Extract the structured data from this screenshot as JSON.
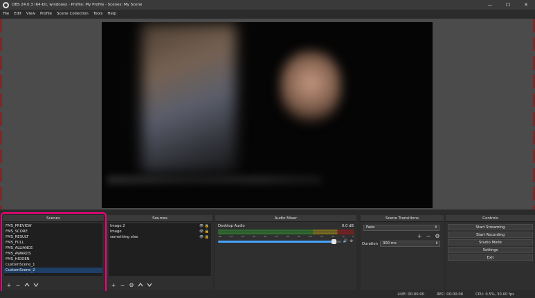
{
  "window": {
    "title": "OBS 24.0.3 (64-bit, windows) - Profile: My Profile - Scenes: My Scene",
    "minimize": "—",
    "maximize": "☐",
    "close": "✕"
  },
  "menu": [
    "File",
    "Edit",
    "View",
    "Profile",
    "Scene Collection",
    "Tools",
    "Help"
  ],
  "scenes": {
    "title": "Scenes",
    "items": [
      "FMS_PREVIEW",
      "FMS_SCORE",
      "FMS_RESULT",
      "FMS_FULL",
      "FMS_ALLIANCE",
      "FMS_AWARDS",
      "FMS_HIDDEN",
      "CustomScene_1",
      "CustomScene_2"
    ],
    "selected_index": 8
  },
  "sources": {
    "title": "Sources",
    "items": [
      "Image 2",
      "Image",
      "something else"
    ]
  },
  "mixer": {
    "title": "Audio Mixer",
    "track_name": "Desktop Audio",
    "track_level": "0.0 dB",
    "scale": [
      "-60",
      "-55",
      "-50",
      "-45",
      "-40",
      "-35",
      "-30",
      "-25",
      "-20",
      "-15",
      "-10",
      "-5",
      "0"
    ],
    "volume_fraction": 0.96
  },
  "transitions": {
    "title": "Scene Transitions",
    "selected": "Fade",
    "duration_label": "Duration",
    "duration_value": "300 ms"
  },
  "controls": {
    "title": "Controls",
    "buttons": [
      "Start Streaming",
      "Start Recording",
      "Studio Mode",
      "Settings",
      "Exit"
    ]
  },
  "status": {
    "live": "LIVE: 00:00:00",
    "rec": "REC: 00:00:00",
    "cpu": "CPU: 0.5%, 30.00 fps"
  },
  "colors": {
    "highlight": "#ff0080",
    "selection": "#1e3f66",
    "volume_accent": "#4aa3ff"
  }
}
